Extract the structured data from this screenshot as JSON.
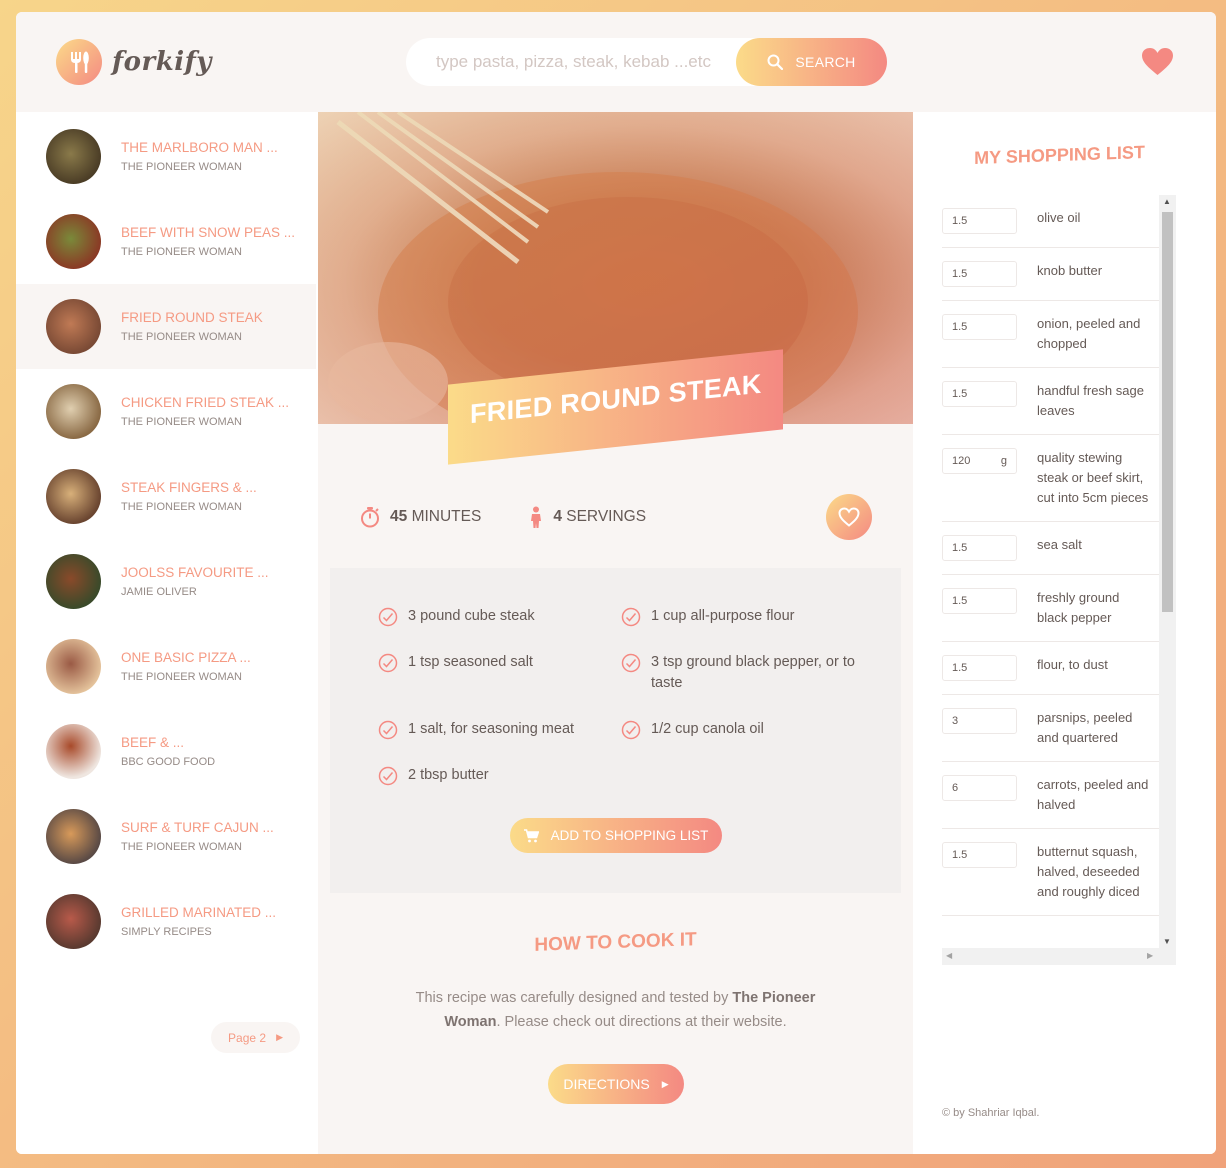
{
  "header": {
    "logo_text": "forkify",
    "search_placeholder": "type pasta, pizza, steak, kebab ...etc",
    "search_button": "SEARCH"
  },
  "results": {
    "items": [
      {
        "title": "THE MARLBORO MAN ...",
        "author": "THE PIONEER WOMAN",
        "active": false
      },
      {
        "title": "BEEF WITH SNOW PEAS ...",
        "author": "THE PIONEER WOMAN",
        "active": false
      },
      {
        "title": "FRIED ROUND STEAK",
        "author": "THE PIONEER WOMAN",
        "active": true
      },
      {
        "title": "CHICKEN FRIED STEAK ...",
        "author": "THE PIONEER WOMAN",
        "active": false
      },
      {
        "title": "STEAK FINGERS & ...",
        "author": "THE PIONEER WOMAN",
        "active": false
      },
      {
        "title": "JOOLSS FAVOURITE ...",
        "author": "JAMIE OLIVER",
        "active": false
      },
      {
        "title": "ONE BASIC PIZZA ...",
        "author": "THE PIONEER WOMAN",
        "active": false
      },
      {
        "title": "BEEF & ...",
        "author": "BBC GOOD FOOD",
        "active": false
      },
      {
        "title": "SURF & TURF CAJUN ...",
        "author": "THE PIONEER WOMAN",
        "active": false
      },
      {
        "title": "GRILLED MARINATED ...",
        "author": "SIMPLY RECIPES",
        "active": false
      }
    ],
    "pager_label": "Page 2"
  },
  "recipe": {
    "title": "FRIED ROUND STEAK",
    "time_value": "45",
    "time_unit": "MINUTES",
    "servings_value": "4",
    "servings_unit": "SERVINGS",
    "ingredients": [
      "3 pound cube steak",
      "1 cup all-purpose flour",
      "1 tsp seasoned salt",
      "3 tsp ground black pepper, or to taste",
      "1 salt, for seasoning meat",
      "1/2 cup canola oil",
      "2 tbsp butter"
    ],
    "add_button": "ADD TO SHOPPING LIST",
    "directions_title": "HOW TO COOK IT",
    "directions_text_1": "This recipe was carefully designed and tested by ",
    "directions_author": "The Pioneer Woman",
    "directions_text_2": ". Please check out directions at their website.",
    "directions_button": "DIRECTIONS"
  },
  "shopping": {
    "title": "MY SHOPPING LIST",
    "items": [
      {
        "count": "1.5",
        "unit": "",
        "desc": "olive oil"
      },
      {
        "count": "1.5",
        "unit": "",
        "desc": "knob butter"
      },
      {
        "count": "1.5",
        "unit": "",
        "desc": "onion, peeled and chopped"
      },
      {
        "count": "1.5",
        "unit": "",
        "desc": "handful fresh sage leaves"
      },
      {
        "count": "120",
        "unit": "g",
        "desc": "quality stewing steak or beef skirt, cut into 5cm pieces"
      },
      {
        "count": "1.5",
        "unit": "",
        "desc": "sea salt"
      },
      {
        "count": "1.5",
        "unit": "",
        "desc": "freshly ground black pepper"
      },
      {
        "count": "1.5",
        "unit": "",
        "desc": "flour, to dust"
      },
      {
        "count": "3",
        "unit": "",
        "desc": "parsnips, peeled and quartered"
      },
      {
        "count": "6",
        "unit": "",
        "desc": "carrots, peeled and halved"
      },
      {
        "count": "1.5",
        "unit": "",
        "desc": "butternut squash, halved, deseeded and roughly diced"
      }
    ]
  },
  "footer": {
    "copyright": "© by Shahriar Iqbal."
  },
  "colors": {
    "accent_start": "#fbdb89",
    "accent_end": "#f48982",
    "accent_text": "#f59a83",
    "panel_bg": "#f9f5f3"
  }
}
